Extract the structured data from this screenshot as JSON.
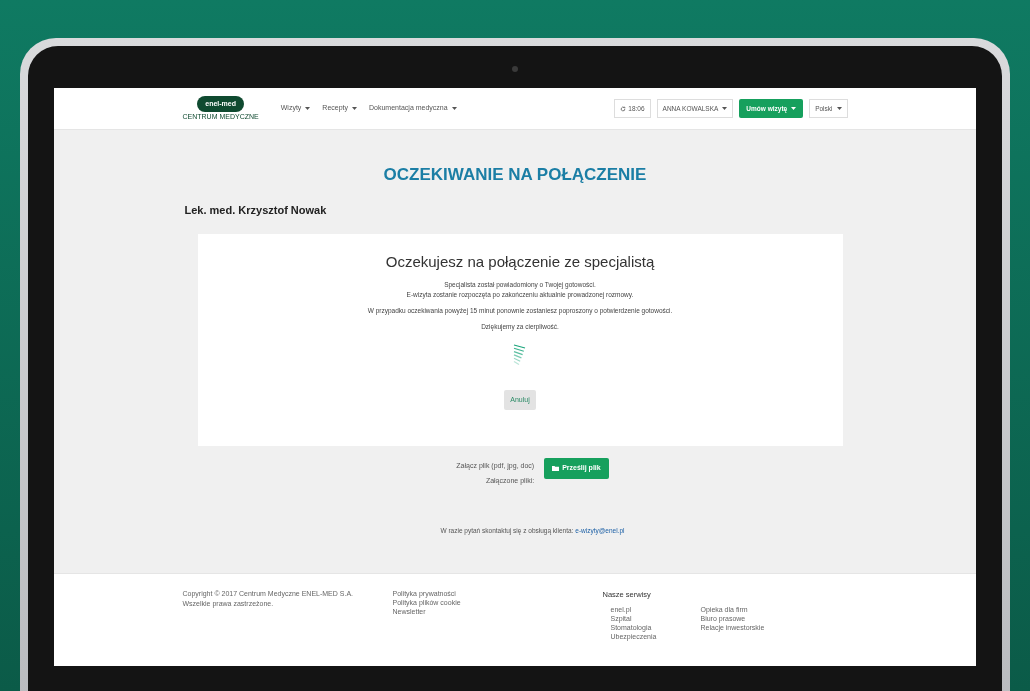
{
  "logo": {
    "name": "enel-med",
    "subtitle": "CENTRUM MEDYCZNE"
  },
  "nav": {
    "menus": [
      {
        "label": "Wizyty"
      },
      {
        "label": "Recepty"
      },
      {
        "label": "Dokumentacja medyczna"
      }
    ],
    "clock": "18:06",
    "user": "ANNA KOWALSKA",
    "book_button": "Umów wizytę",
    "language": "Polski"
  },
  "page_title": "OCZEKIWANIE NA POŁĄCZENIE",
  "doctor": "Lek. med. Krzysztof Nowak",
  "card": {
    "heading": "Oczekujesz na połączenie ze specjalistą",
    "paragraphs": [
      [
        "Specjalista został powiadomiony o Twojej gotowości.",
        "E-wizyta zostanie rozpoczęta po zakończeniu aktualnie prowadzonej rozmowy."
      ],
      [
        "W przypadku oczekiwania powyżej 15 minut ponownie zostaniesz poproszony o potwierdzenie gotowości."
      ],
      [
        "Dziękujemy za cierpliwość."
      ]
    ],
    "cancel_button": "Anuluj"
  },
  "attach": {
    "label": "Załącz plik (pdf, jpg, doc)",
    "button": "Prześlij plik",
    "attached_label": "Załączone pliki:"
  },
  "contact": {
    "text": "W razie pytań skontaktuj się z obsługą klienta:",
    "email": "e-wizyty@enel.pl"
  },
  "footer": {
    "copyright": [
      "Copyright © 2017 Centrum Medyczne ENEL-MED S.A.",
      "Wszelkie prawa zastrzeżone."
    ],
    "links": [
      "Polityka prywatności",
      "Polityka plików cookie",
      "Newsletter"
    ],
    "services_title": "Nasze serwisy",
    "services": [
      [
        "enel.pl",
        "Szpital",
        "Stomatologia",
        "Ubezpieczenia"
      ],
      [
        "Opieka dla firm",
        "Biuro prasowe",
        "Relacje inwestorskie"
      ]
    ]
  }
}
